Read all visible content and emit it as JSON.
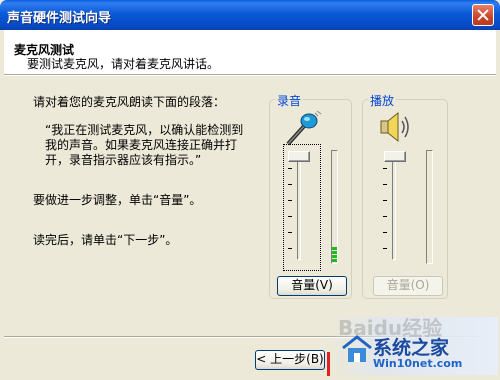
{
  "window": {
    "title": "声音硬件测试向导"
  },
  "header": {
    "title": "麦克风测试",
    "description": "要测试麦克风，请对着麦克风讲话。"
  },
  "body": {
    "instruction": "请对着您的麦克风朗读下面的段落：",
    "paragraph_line1": "“我正在测试麦克风，以确认能检测到",
    "paragraph_line2": "我的声音。如果麦克风连接正确并打",
    "paragraph_line3": "开，录音指示器应该有指示。”",
    "adjust_hint": "要做进一步调整，单击“音量”。",
    "next_hint": "读完后，请单击“下一步”。"
  },
  "recording": {
    "label": "录音",
    "volume_button": "音量(V)",
    "level_segments_lit": 4
  },
  "playback": {
    "label": "播放",
    "volume_button": "音量(O)",
    "volume_button_enabled": false
  },
  "footer": {
    "back_button": "< 上一步(B)"
  },
  "watermark": {
    "brand": "系统之家",
    "url": "Win10net.com",
    "bg_text": "Baidu经验"
  },
  "colors": {
    "titlebar": "#0b5ad6",
    "group_label": "#0046d5",
    "meter_lit": "#22b922"
  }
}
